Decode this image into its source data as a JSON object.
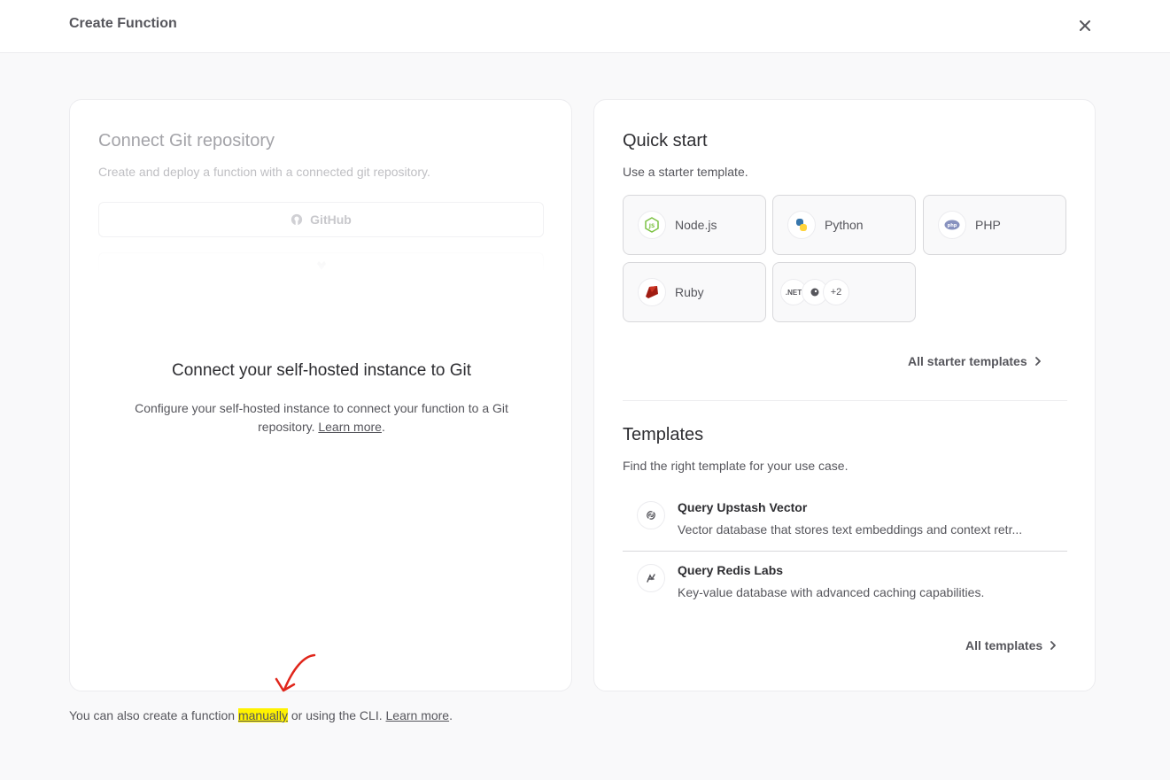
{
  "header": {
    "title": "Create Function"
  },
  "git": {
    "title": "Connect Git repository",
    "subtitle": "Create and deploy a function with a connected git repository.",
    "github_label": "GitHub",
    "selfhost_title": "Connect your self-hosted instance to Git",
    "selfhost_desc": "Configure your self-hosted instance to connect your function to a Git repository.",
    "learn_more": "Learn more"
  },
  "quickstart": {
    "title": "Quick start",
    "subtitle": "Use a starter template.",
    "runtimes": [
      {
        "label": "Node.js",
        "icon": "nodejs-icon"
      },
      {
        "label": "Python",
        "icon": "python-icon"
      },
      {
        "label": "PHP",
        "icon": "php-icon"
      },
      {
        "label": "Ruby",
        "icon": "ruby-icon"
      }
    ],
    "more": {
      "dotnet": ".NET",
      "count": "+2"
    },
    "all_link": "All starter templates"
  },
  "templates": {
    "title": "Templates",
    "subtitle": "Find the right template for your use case.",
    "items": [
      {
        "name": "Query Upstash Vector",
        "desc": "Vector database that stores text embeddings and context retr...",
        "icon": "upstash-icon"
      },
      {
        "name": "Query Redis Labs",
        "desc": "Key-value database with advanced caching capabilities.",
        "icon": "redis-icon"
      }
    ],
    "all_link": "All templates"
  },
  "footer": {
    "prefix": "You can also create a function",
    "manually": "manually",
    "middle": "or using the CLI.",
    "learn_more": "Learn more"
  },
  "colors": {
    "highlight": "#fff200",
    "annotation": "#e0261b"
  }
}
